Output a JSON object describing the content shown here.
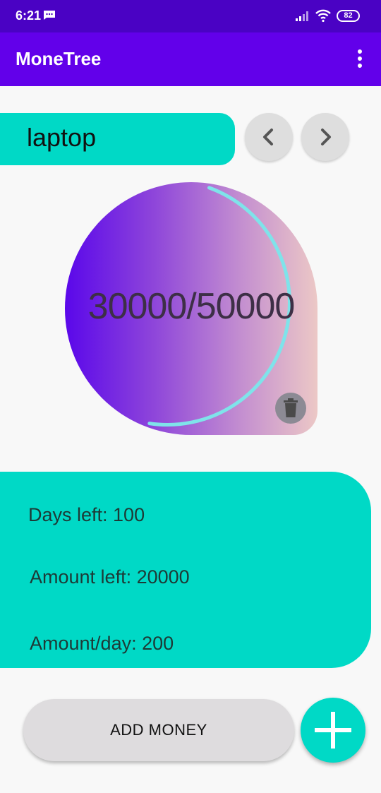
{
  "status_bar": {
    "time": "6:21",
    "battery": "82"
  },
  "app_bar": {
    "title": "MoneTree"
  },
  "goal": {
    "name": "laptop"
  },
  "progress": {
    "text": "30000/50000",
    "fraction": 0.6
  },
  "stats": {
    "days_left": "Days left: 100",
    "amount_left": "Amount left: 20000",
    "amount_per_day": "Amount/day: 200"
  },
  "actions": {
    "add_money_label": "ADD MONEY"
  },
  "colors": {
    "status_bar": "#4a02c4",
    "app_bar": "#6200ea",
    "accent": "#00d9c6",
    "progress_ring": "#7fe3ea",
    "button_grey": "#dedede"
  },
  "icons": {
    "message": "message-icon",
    "signal": "signal-icon",
    "wifi": "wifi-icon",
    "battery": "battery-icon",
    "menu": "more-vert-icon",
    "prev": "chevron-left-icon",
    "next": "chevron-right-icon",
    "delete": "trash-icon",
    "add": "plus-icon"
  }
}
